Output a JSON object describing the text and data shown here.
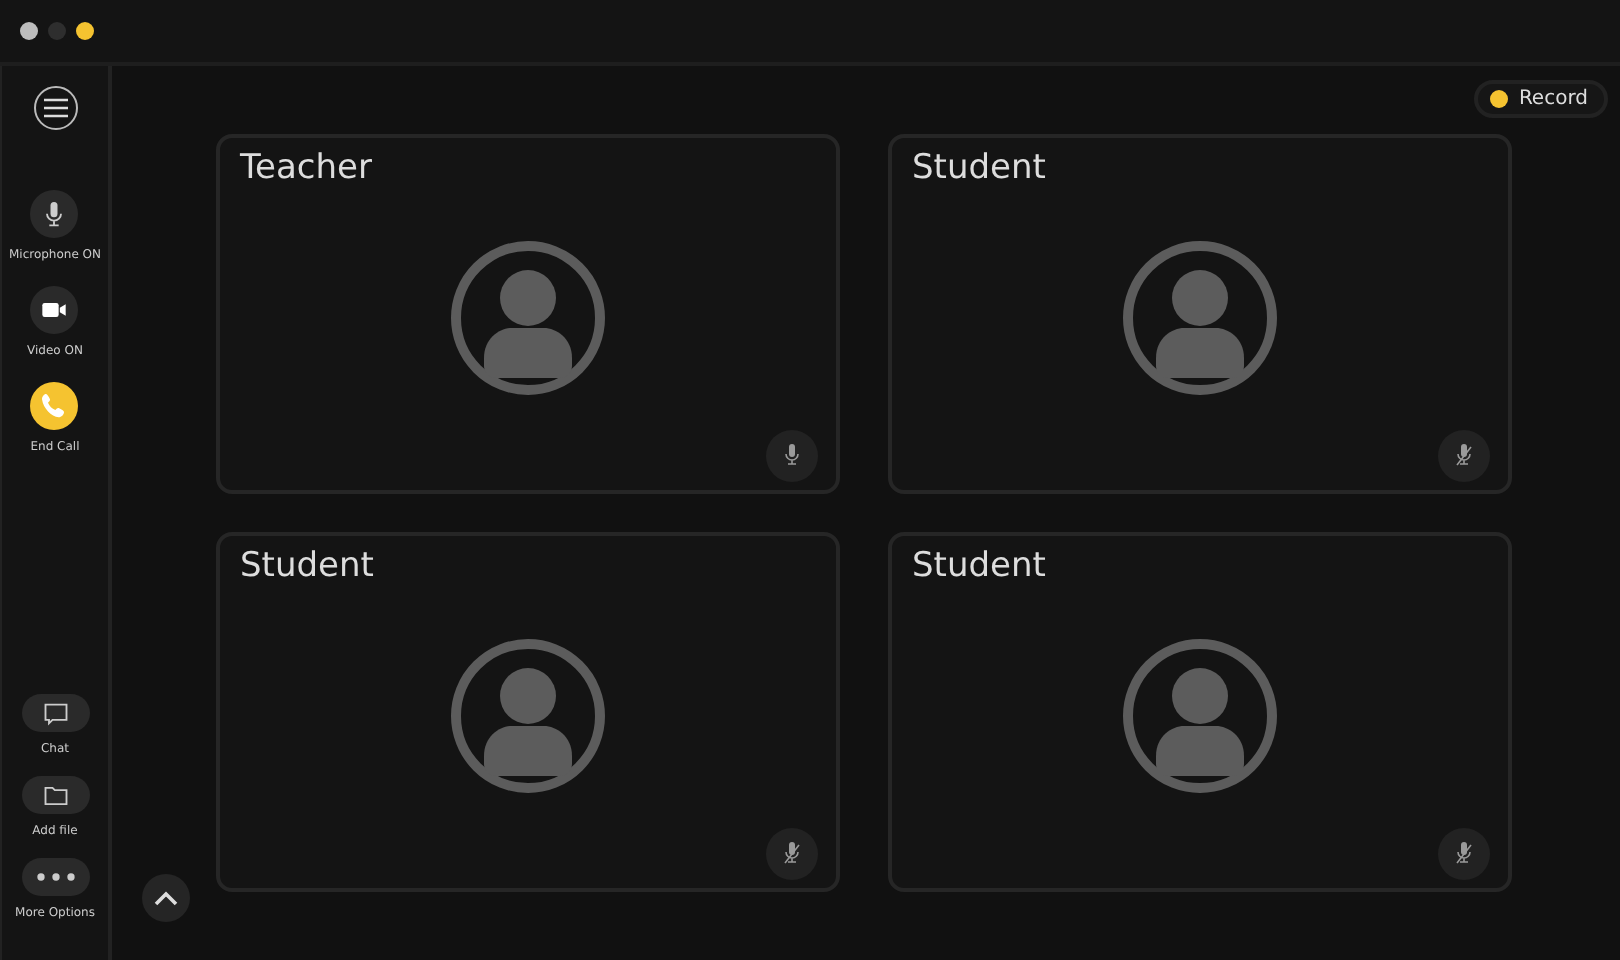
{
  "window": {
    "dots": [
      {
        "color": "#bdbdbd"
      },
      {
        "color": "#2e2e2e"
      },
      {
        "color": "#f5c330"
      }
    ]
  },
  "sidebar": {
    "top": [
      {
        "kind": "mic",
        "label": "Microphone ON"
      },
      {
        "kind": "video",
        "label": "Video ON"
      },
      {
        "kind": "end-call",
        "label": "End Call"
      }
    ],
    "bottom": [
      {
        "kind": "chat",
        "label": "Chat"
      },
      {
        "kind": "folder",
        "label": "Add file"
      },
      {
        "kind": "more",
        "label": "More Options"
      }
    ]
  },
  "record": {
    "label": "Record"
  },
  "participants": [
    {
      "name": "Teacher",
      "muted": false
    },
    {
      "name": "Student",
      "muted": true
    },
    {
      "name": "Student",
      "muted": true
    },
    {
      "name": "Student",
      "muted": true
    }
  ]
}
